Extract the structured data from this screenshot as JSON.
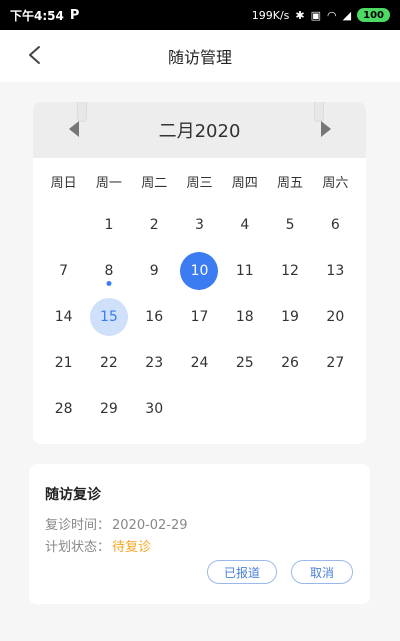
{
  "status_bar": {
    "time": "下午4:54",
    "p_icon": "P",
    "speed": "199K/s",
    "battery": "100"
  },
  "nav": {
    "title": "随访管理",
    "back_icon": "chevron-left-icon"
  },
  "calendar": {
    "month_title": "二月2020",
    "weekdays": [
      "周日",
      "周一",
      "周二",
      "周三",
      "周四",
      "周五",
      "周六"
    ],
    "rows": [
      [
        "",
        "1",
        "2",
        "3",
        "4",
        "5",
        "6"
      ],
      [
        "7",
        "8",
        "9",
        "10",
        "11",
        "12",
        "13"
      ],
      [
        "14",
        "15",
        "16",
        "17",
        "18",
        "19",
        "20"
      ],
      [
        "21",
        "22",
        "23",
        "24",
        "25",
        "26",
        "27"
      ],
      [
        "28",
        "29",
        "30",
        "",
        "",
        "",
        ""
      ]
    ],
    "selected_day": "10",
    "today_day": "15",
    "dot_day": "8"
  },
  "visit": {
    "title": "随访复诊",
    "date_label": "复诊时间：",
    "date_value": "2020-02-29",
    "status_label": "计划状态：",
    "status_value": "待复诊",
    "btn_reported": "已报道",
    "btn_cancel": "取消"
  },
  "colors": {
    "accent": "#3b7cf2",
    "status_pending": "#f5a623"
  }
}
